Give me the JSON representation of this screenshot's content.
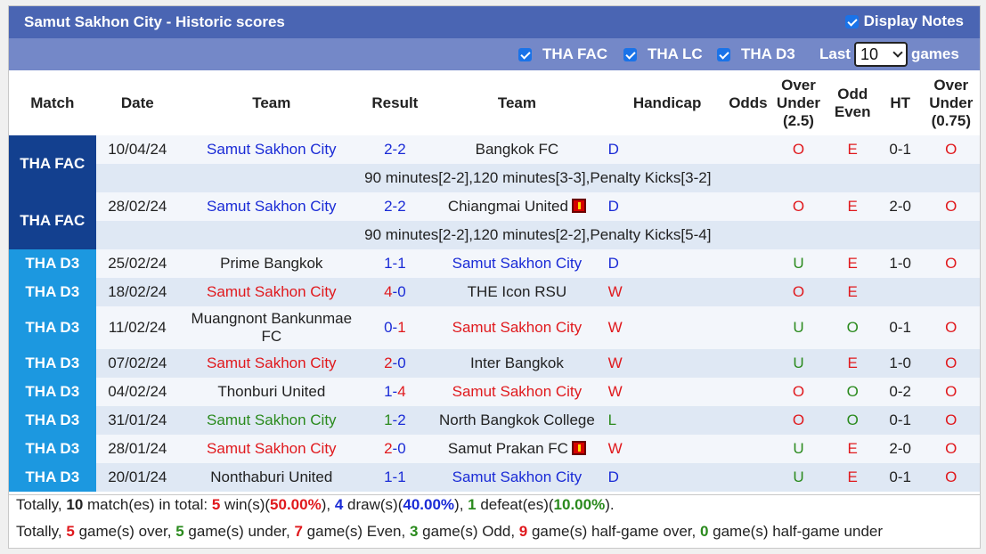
{
  "header": {
    "title": "Samut Sakhon City - Historic scores",
    "display_notes_label": "Display Notes"
  },
  "filters": {
    "items": [
      {
        "label": "THA FAC",
        "checked": true
      },
      {
        "label": "THA LC",
        "checked": true
      },
      {
        "label": "THA D3",
        "checked": true
      }
    ],
    "last_label": "Last",
    "last_value": "10",
    "games_label": "games"
  },
  "table": {
    "columns": {
      "match": "Match",
      "date": "Date",
      "team1": "Team",
      "result": "Result",
      "team2": "Team",
      "handicap": "Handicap",
      "odds": "Odds",
      "ou_line1": "Over",
      "ou_line2": "Under",
      "ou_line3": "(2.5)",
      "oe_line1": "Odd",
      "oe_line2": "Even",
      "ht": "HT",
      "ou2_line1": "Over",
      "ou2_line2": "Under",
      "ou2_line3": "(0.75)"
    },
    "rows": [
      {
        "league": "THA FAC",
        "date": "10/04/24",
        "home": "Samut Sakhon City",
        "score_home": "2",
        "score_away": "2",
        "away": "Bangkok FC",
        "away_card": false,
        "wdl": "D",
        "ou": "O",
        "oe": "E",
        "ht": "0-1",
        "ou2": "O",
        "note": "90 minutes[2-2],120 minutes[3-3],Penalty Kicks[3-2]"
      },
      {
        "league": "THA FAC",
        "date": "28/02/24",
        "home": "Samut Sakhon City",
        "score_home": "2",
        "score_away": "2",
        "away": "Chiangmai United",
        "away_card": true,
        "wdl": "D",
        "ou": "O",
        "oe": "E",
        "ht": "2-0",
        "ou2": "O",
        "note": "90 minutes[2-2],120 minutes[2-2],Penalty Kicks[5-4]"
      },
      {
        "league": "THA D3",
        "date": "25/02/24",
        "home": "Prime Bangkok",
        "score_home": "1",
        "score_away": "1",
        "away": "Samut Sakhon City",
        "away_card": false,
        "wdl": "D",
        "ou": "U",
        "oe": "E",
        "ht": "1-0",
        "ou2": "O"
      },
      {
        "league": "THA D3",
        "date": "18/02/24",
        "home": "Samut Sakhon City",
        "score_home": "4",
        "score_away": "0",
        "away": "THE Icon RSU",
        "away_card": false,
        "wdl": "W",
        "ou": "O",
        "oe": "E",
        "ht": "",
        "ou2": ""
      },
      {
        "league": "THA D3",
        "date": "11/02/24",
        "home": "Muangnont Bankunmae FC",
        "score_home": "0",
        "score_away": "1",
        "away": "Samut Sakhon City",
        "away_card": false,
        "wdl": "W",
        "ou": "U",
        "oe": "O",
        "ht": "0-1",
        "ou2": "O"
      },
      {
        "league": "THA D3",
        "date": "07/02/24",
        "home": "Samut Sakhon City",
        "score_home": "2",
        "score_away": "0",
        "away": "Inter Bangkok",
        "away_card": false,
        "wdl": "W",
        "ou": "U",
        "oe": "E",
        "ht": "1-0",
        "ou2": "O"
      },
      {
        "league": "THA D3",
        "date": "04/02/24",
        "home": "Thonburi United",
        "score_home": "1",
        "score_away": "4",
        "away": "Samut Sakhon City",
        "away_card": false,
        "wdl": "W",
        "ou": "O",
        "oe": "O",
        "ht": "0-2",
        "ou2": "O"
      },
      {
        "league": "THA D3",
        "date": "31/01/24",
        "home": "Samut Sakhon City",
        "score_home": "1",
        "score_away": "2",
        "away": "North Bangkok College",
        "away_card": false,
        "wdl": "L",
        "ou": "O",
        "oe": "O",
        "ht": "0-1",
        "ou2": "O"
      },
      {
        "league": "THA D3",
        "date": "28/01/24",
        "home": "Samut Sakhon City",
        "score_home": "2",
        "score_away": "0",
        "away": "Samut Prakan FC",
        "away_card": true,
        "wdl": "W",
        "ou": "U",
        "oe": "E",
        "ht": "2-0",
        "ou2": "O"
      },
      {
        "league": "THA D3",
        "date": "20/01/24",
        "home": "Nonthaburi United",
        "score_home": "1",
        "score_away": "1",
        "away": "Samut Sakhon City",
        "away_card": false,
        "wdl": "D",
        "ou": "U",
        "oe": "E",
        "ht": "0-1",
        "ou2": "O"
      }
    ]
  },
  "summary": {
    "line1": {
      "p1": "Totally, ",
      "matches": "10",
      "p2": " match(es) in total: ",
      "wins": "5",
      "p3": " win(s)(",
      "win_pct": "50.00%",
      "p4": "), ",
      "draws": "4",
      "p5": " draw(s)(",
      "draw_pct": "40.00%",
      "p6": "), ",
      "defeats": "1",
      "p7": " defeat(es)(",
      "defeat_pct": "10.00%",
      "p8": ")."
    },
    "line2": {
      "p1": "Totally, ",
      "over": "5",
      "p2": " game(s) over, ",
      "under": "5",
      "p3": " game(s) under, ",
      "even": "7",
      "p4": " game(s) Even, ",
      "odd": "3",
      "p5": " game(s) Odd, ",
      "hg_over": "9",
      "p6": " game(s) half-game over, ",
      "hg_under": "0",
      "p7": " game(s) half-game under"
    }
  },
  "colors": {
    "title_bg": "#4a65b3",
    "filter_bg": "#7488c8",
    "league_fac": "#13408f",
    "league_d3": "#1c98e0",
    "win": "#e0191d",
    "draw": "#1a2bd6",
    "loss": "#2a8a1d"
  }
}
